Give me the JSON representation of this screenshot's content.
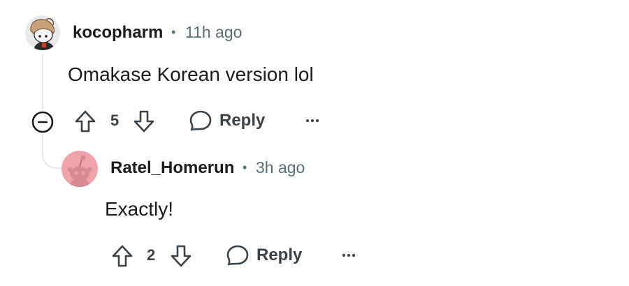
{
  "comments": [
    {
      "author": "kocopharm",
      "separator": "•",
      "time": "11h ago",
      "body": "Omakase Korean version lol",
      "votes": "5",
      "reply_label": "Reply",
      "avatar_icon": "snoo-avatar-icon"
    },
    {
      "author": "Ratel_Homerun",
      "separator": "•",
      "time": "3h ago",
      "body": "Exactly!",
      "votes": "2",
      "reply_label": "Reply",
      "avatar_icon": "default-snoo-avatar-icon",
      "avatar_bg": "#f0a3a8"
    }
  ],
  "colors": {
    "text": "#1c1c1c",
    "meta": "#576f76",
    "action": "#3a4247",
    "thread_line": "#e5e7ea"
  }
}
